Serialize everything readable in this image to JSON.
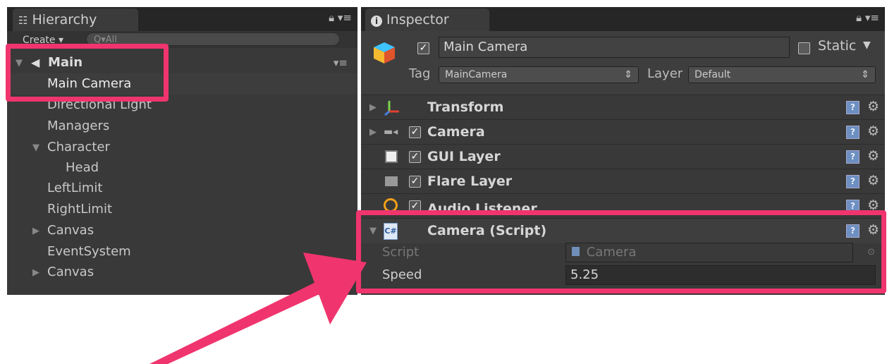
{
  "hierarchy": {
    "tab_title": "Hierarchy",
    "create_label": "Create ▾",
    "search_placeholder": "Q▾All",
    "scene_name": "Main",
    "items": [
      {
        "label": "Main Camera"
      },
      {
        "label": "Directional Light"
      },
      {
        "label": "Managers"
      },
      {
        "label": "Character"
      },
      {
        "label": "Head"
      },
      {
        "label": "LeftLimit"
      },
      {
        "label": "RightLimit"
      },
      {
        "label": "Canvas"
      },
      {
        "label": "EventSystem"
      },
      {
        "label": "Canvas"
      }
    ]
  },
  "inspector": {
    "tab_title": "Inspector",
    "object_name": "Main Camera",
    "static_label": "Static",
    "tag_label": "Tag",
    "tag_value": "MainCamera",
    "layer_label": "Layer",
    "layer_value": "Default",
    "components": [
      {
        "name": "Transform"
      },
      {
        "name": "Camera"
      },
      {
        "name": "GUI Layer"
      },
      {
        "name": "Flare Layer"
      },
      {
        "name": "Audio Listener"
      },
      {
        "name": "Camera (Script)"
      }
    ],
    "script_label": "Script",
    "script_value": "Camera",
    "speed_label": "Speed",
    "speed_value": "5.25"
  },
  "colors": {
    "highlight": "#f0356e",
    "panel_bg": "#393939",
    "tabbar_bg": "#262626"
  }
}
